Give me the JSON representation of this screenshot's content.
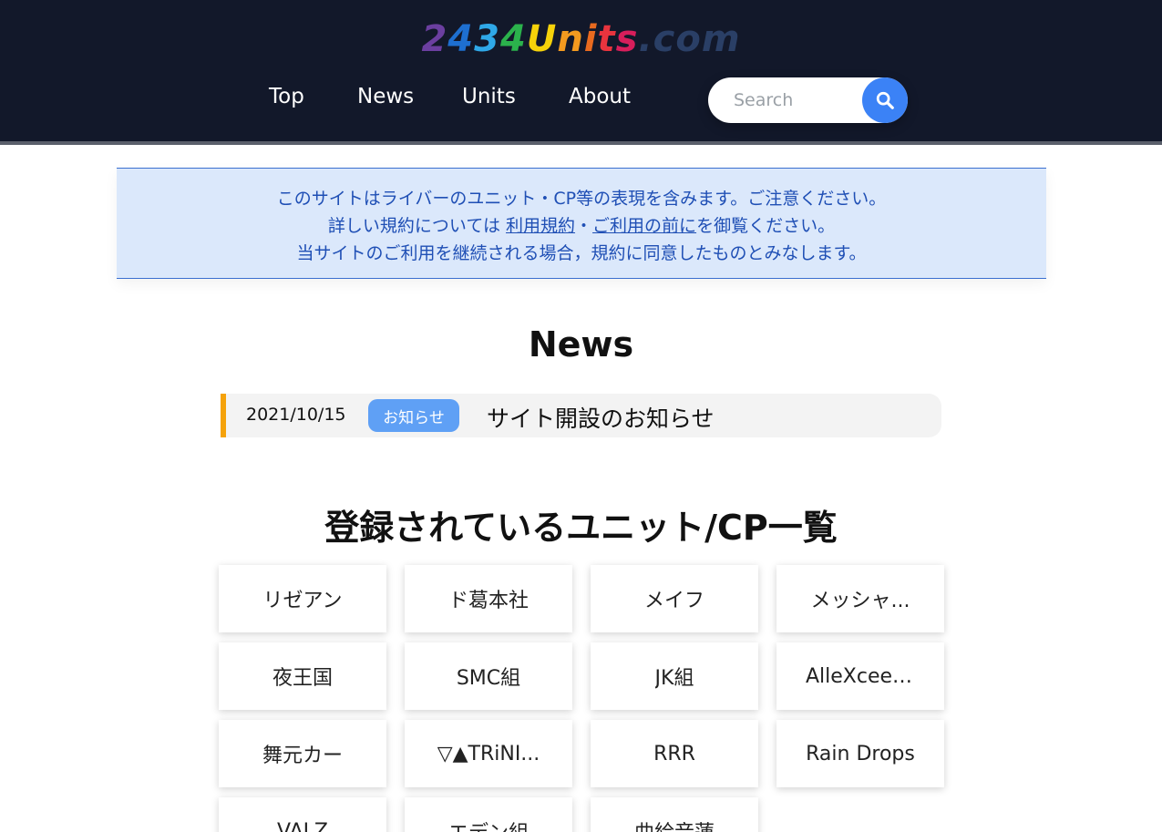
{
  "header": {
    "logo": [
      {
        "char": "2",
        "color": "#6b3fa0"
      },
      {
        "char": "4",
        "color": "#1e6fd0"
      },
      {
        "char": "3",
        "color": "#2fa8e8"
      },
      {
        "char": "4",
        "color": "#2bb24c"
      },
      {
        "char": "U",
        "color": "#f6d20a"
      },
      {
        "char": "n",
        "color": "#f39a1f"
      },
      {
        "char": "i",
        "color": "#e96a1f"
      },
      {
        "char": "t",
        "color": "#e8343e"
      },
      {
        "char": "s",
        "color": "#d81e5b"
      },
      {
        "char": ".com",
        "color": "#2a3f66"
      }
    ],
    "nav": [
      {
        "label": "Top"
      },
      {
        "label": "News"
      },
      {
        "label": "Units"
      },
      {
        "label": "About"
      }
    ],
    "search": {
      "placeholder": "Search",
      "icon": "search-icon"
    }
  },
  "notice": {
    "line1": "このサイトはライバーのユニット・CP等の表現を含みます。ご注意ください。",
    "line2_prefix": "詳しい規約については ",
    "line2_link1": "利用規約",
    "line2_sep": "・",
    "line2_link2": "ご利用の前に",
    "line2_suffix": "を御覧ください。",
    "line3": "当サイトのご利用を継続される場合，規約に同意したものとみなします。"
  },
  "news": {
    "heading": "News",
    "items": [
      {
        "date": "2021/10/15",
        "badge": "お知らせ",
        "title": "サイト開設のお知らせ"
      }
    ]
  },
  "units": {
    "heading": "登録されているユニット/CP一覧",
    "items": [
      {
        "label": "リゼアン"
      },
      {
        "label": "ド葛本社"
      },
      {
        "label": "メイフ"
      },
      {
        "label": "メッシャ..."
      },
      {
        "label": "夜王国"
      },
      {
        "label": "SMC組"
      },
      {
        "label": "JK組"
      },
      {
        "label": "AlleXceed ..."
      },
      {
        "label": "舞元カー"
      },
      {
        "label": "▽▲TRiNI..."
      },
      {
        "label": "RRR"
      },
      {
        "label": "Rain Drops"
      },
      {
        "label": "VALZ"
      },
      {
        "label": "エデン組"
      },
      {
        "label": "曲絵音蓮"
      }
    ]
  },
  "colors": {
    "header_bg": "#12182a",
    "accent": "#3b82f6",
    "notice_bg": "#dbe8fb",
    "notice_text": "#1f4fb5",
    "news_accent": "#f5a20a",
    "badge_bg": "#5fa0f5"
  }
}
